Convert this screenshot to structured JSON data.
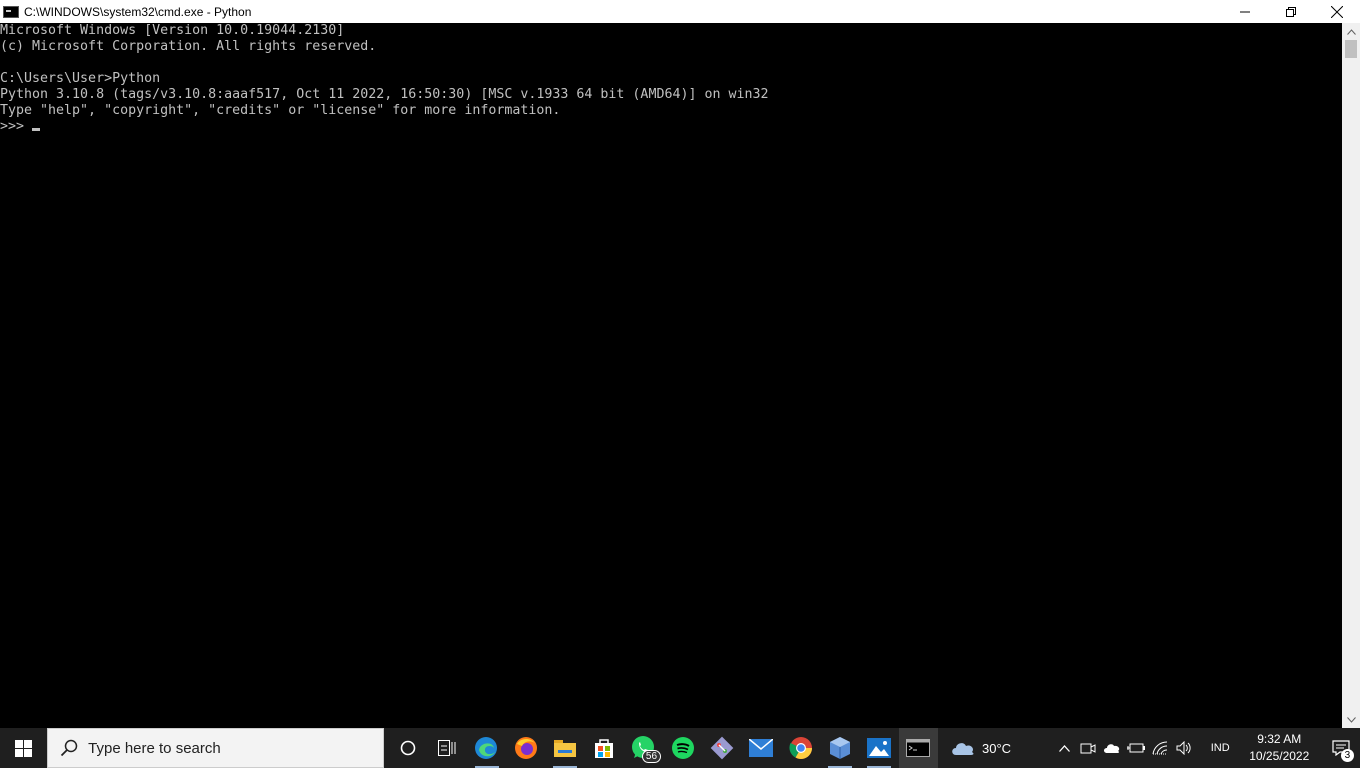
{
  "window": {
    "title": "C:\\WINDOWS\\system32\\cmd.exe - Python",
    "icon": "cmd-icon",
    "controls": {
      "minimize": "minimize-icon",
      "restore": "restore-icon",
      "close": "close-icon"
    }
  },
  "console": {
    "lines": [
      "Microsoft Windows [Version 10.0.19044.2130]",
      "(c) Microsoft Corporation. All rights reserved.",
      "",
      "C:\\Users\\User>Python",
      "Python 3.10.8 (tags/v3.10.8:aaaf517, Oct 11 2022, 16:50:30) [MSC v.1933 64 bit (AMD64)] on win32",
      "Type \"help\", \"copyright\", \"credits\" or \"license\" for more information."
    ],
    "prompt": ">>> ",
    "text_color": "#c0c0c0",
    "background": "#000000"
  },
  "taskbar": {
    "search_placeholder": "Type here to search",
    "apps": [
      {
        "name": "cortana-icon"
      },
      {
        "name": "task-view-icon"
      },
      {
        "name": "edge-icon"
      },
      {
        "name": "firefox-icon"
      },
      {
        "name": "file-explorer-icon"
      },
      {
        "name": "microsoft-store-icon"
      },
      {
        "name": "whatsapp-icon",
        "badge": "56"
      },
      {
        "name": "spotify-icon"
      },
      {
        "name": "git-icon"
      },
      {
        "name": "mail-icon"
      },
      {
        "name": "chrome-icon"
      },
      {
        "name": "virtualbox-icon"
      },
      {
        "name": "photos-icon"
      },
      {
        "name": "cmd-icon"
      }
    ],
    "weather": {
      "temp": "30°C",
      "icon": "cloud-icon"
    },
    "tray": [
      "chevron-up-icon",
      "meet-now-icon",
      "onedrive-icon",
      "battery-icon",
      "wifi-icon",
      "volume-icon"
    ],
    "language": "IND",
    "time": "9:32 AM",
    "date": "10/25/2022",
    "notifications": "3"
  }
}
